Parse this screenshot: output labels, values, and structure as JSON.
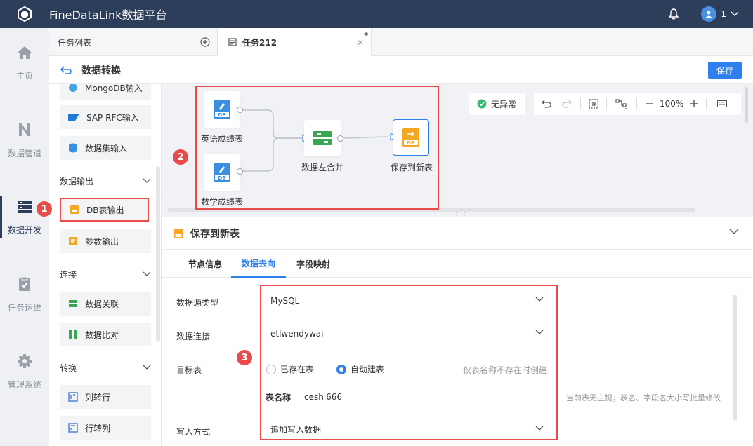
{
  "app": {
    "title": "FineDataLink数据平台",
    "user": "1"
  },
  "nav": [
    {
      "label": "主页",
      "icon": "home-icon"
    },
    {
      "label": "数据管道",
      "icon": "pipeline-icon"
    },
    {
      "label": "数据开发",
      "icon": "dev-icon",
      "active": true
    },
    {
      "label": "任务运维",
      "icon": "ops-icon"
    },
    {
      "label": "管理系统",
      "icon": "gear-icon"
    }
  ],
  "tabs": {
    "list_label": "任务列表",
    "task_label": "任务212",
    "modified_mark": "*"
  },
  "header": {
    "title": "数据转换",
    "save_label": "保存"
  },
  "components": {
    "items_top": [
      "MongoDB输入",
      "SAP RFC输入",
      "数据集输入"
    ],
    "groups": {
      "output": {
        "title": "数据输出",
        "items": [
          "DB表输出",
          "参数输出"
        ]
      },
      "connect": {
        "title": "连接",
        "items": [
          "数据关联",
          "数据比对"
        ]
      },
      "transform": {
        "title": "转换",
        "items": [
          "列转行",
          "行转列"
        ]
      }
    }
  },
  "badges": [
    "1",
    "2",
    "3"
  ],
  "canvas": {
    "nodes": {
      "english": "英语成绩表",
      "math": "数学成绩表",
      "merge": "数据左合并",
      "save": "保存到新表"
    },
    "db_text": "DB",
    "status": "无异常",
    "zoom": "100%"
  },
  "config": {
    "title": "保存到新表",
    "subtabs": [
      "节点信息",
      "数据去向",
      "字段映射"
    ],
    "active_subtab": 1,
    "fields": {
      "source_type_label": "数据源类型",
      "source_type_value": "MySQL",
      "connection_label": "数据连接",
      "connection_value": "etlwendywai",
      "target_label": "目标表",
      "radio_existing": "已存在表",
      "radio_auto": "自动建表",
      "auto_hint": "仅表名称不存在时创建",
      "table_name_label": "表名称",
      "table_name_value": "ceshi666",
      "case_hint": "当前表无主键；表名、字段名大小写批量修改",
      "write_mode_label": "写入方式",
      "write_mode_value": "追加写入数据"
    }
  },
  "colors": {
    "primary": "#2f80ed",
    "topbar": "#2c3e5a",
    "highlight": "#e94a4a",
    "ok": "#3cb97a"
  }
}
